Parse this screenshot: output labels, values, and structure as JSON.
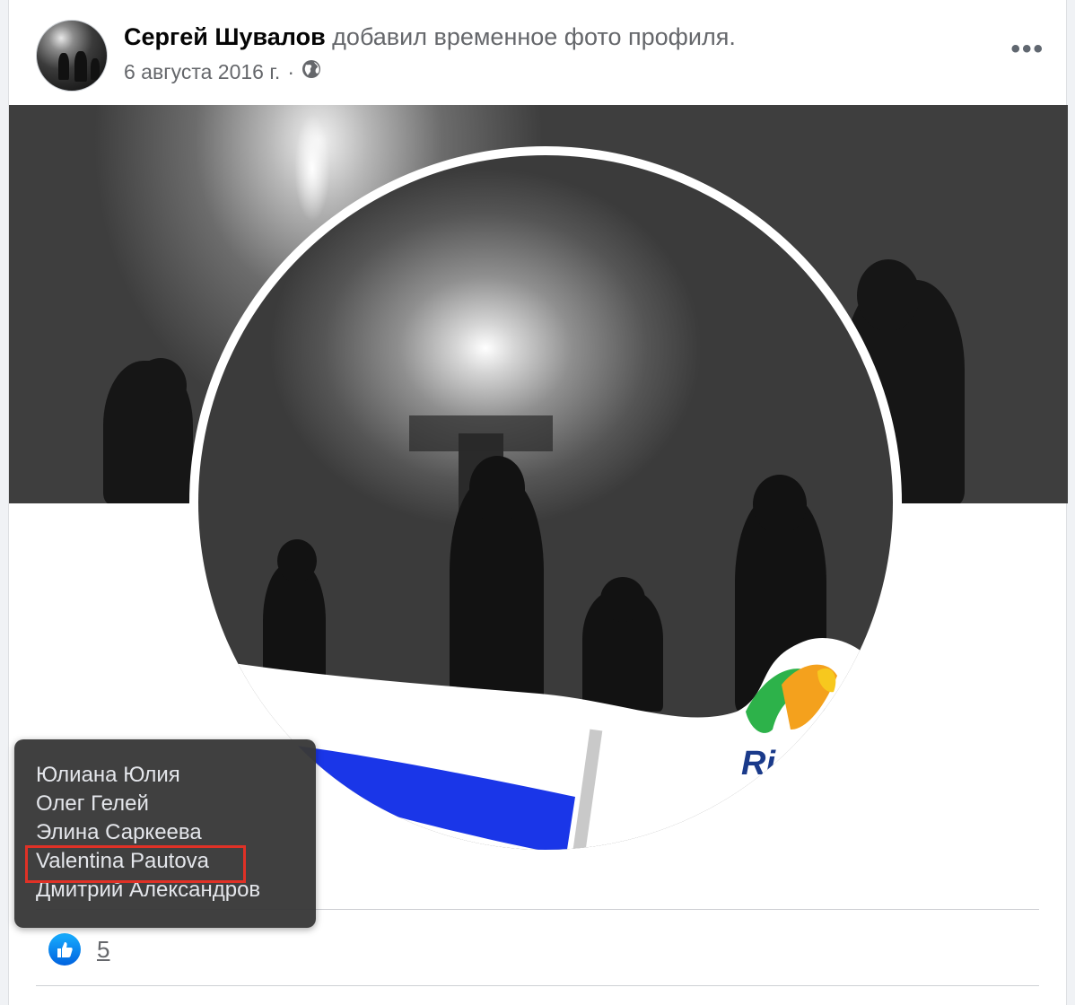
{
  "post": {
    "author": "Сергей Шувалов",
    "action": " добавил временное фото профиля.",
    "date": "6 августа 2016 г.",
    "separator": "·",
    "privacy_icon": "globe-icon",
    "more_label": "•••"
  },
  "tooltip": {
    "names": [
      "Юлиана Юлия",
      "Олег Гелей",
      "Элина Саркеева",
      "Valentina Pautova",
      "Дмитрий Александров"
    ],
    "highlighted_index": 3,
    "highlight_color": "#e03126"
  },
  "reactions": {
    "icon": "like-icon",
    "count": "5",
    "accent": "#1877f2"
  }
}
